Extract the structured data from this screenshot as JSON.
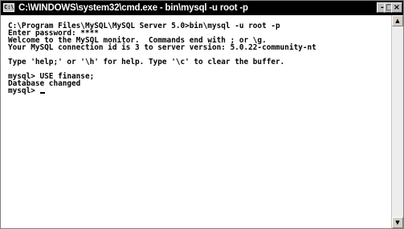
{
  "window": {
    "title": "C:\\WINDOWS\\system32\\cmd.exe - bin\\mysql -u root -p",
    "icon_text": "C:\\",
    "minimize_glyph": "-",
    "maximize_glyph": "□",
    "close_glyph": "×"
  },
  "console": {
    "lines": [
      "C:\\Program Files\\MySQL\\MySQL Server 5.0>bin\\mysql -u root -p",
      "Enter password: ****",
      "Welcome to the MySQL monitor.  Commands end with ; or \\g.",
      "Your MySQL connection id is 3 to server version: 5.0.22-community-nt",
      "",
      "Type 'help;' or '\\h' for help. Type '\\c' to clear the buffer.",
      "",
      "mysql> USE finanse;",
      "Database changed",
      "mysql> "
    ]
  },
  "scrollbar": {
    "up_glyph": "▲",
    "down_glyph": "▼"
  },
  "colors": {
    "titlebar": "#000000",
    "title_text": "#ffffff",
    "console_bg": "#ffffff",
    "console_text": "#000000"
  }
}
